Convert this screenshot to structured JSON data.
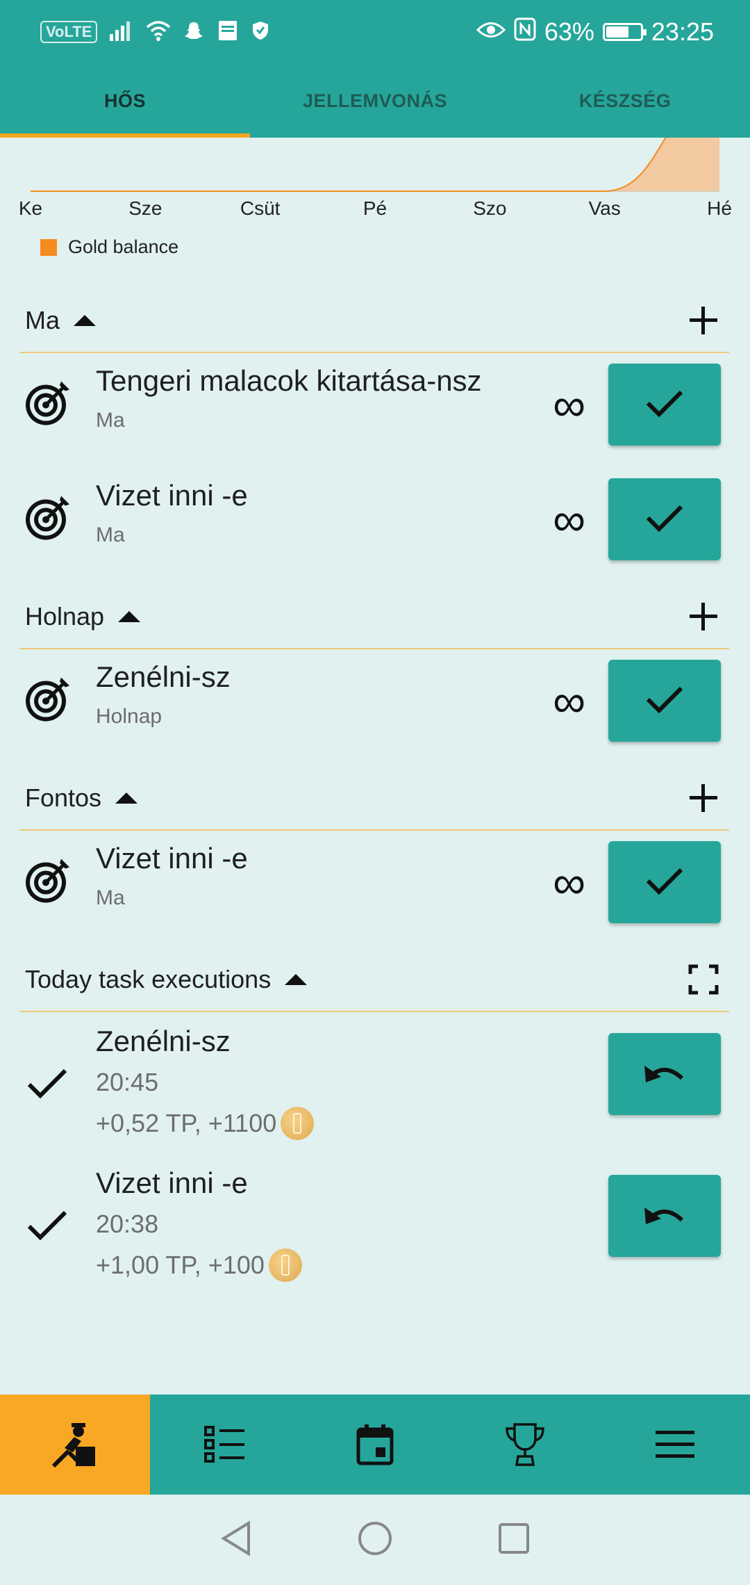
{
  "status_bar": {
    "volte": "VoLTE",
    "battery_percent": "63%",
    "battery_level": 0.63,
    "time": "23:25",
    "icons": [
      "signal-icon",
      "wifi-icon",
      "snapchat-icon",
      "bible-app-icon",
      "shield-icon",
      "eye-comfort-icon",
      "nfc-icon",
      "battery-icon"
    ]
  },
  "tabs": [
    {
      "label": "HŐS",
      "active": true
    },
    {
      "label": "JELLEMVONÁS",
      "active": false
    },
    {
      "label": "KÉSZSÉG",
      "active": false
    }
  ],
  "chart_data": {
    "type": "area",
    "categories": [
      "Ke",
      "Sze",
      "Csüt",
      "Pé",
      "Szo",
      "Vas",
      "Hé"
    ],
    "series": [
      {
        "name": "Gold balance",
        "values": [
          0,
          0,
          0,
          0,
          0,
          0,
          1200
        ],
        "color": "#f58a1f"
      }
    ],
    "legend": "bottom-left"
  },
  "sections": {
    "today": {
      "title": "Ma",
      "items": [
        {
          "title": "Tengeri malacok kitartása-nsz",
          "subtitle": "Ma"
        },
        {
          "title": "Vizet inni -e",
          "subtitle": "Ma"
        }
      ]
    },
    "tomorrow": {
      "title": "Holnap",
      "items": [
        {
          "title": "Zenélni-sz",
          "subtitle": "Holnap"
        }
      ]
    },
    "important": {
      "title": "Fontos",
      "items": [
        {
          "title": "Vizet inni -e",
          "subtitle": "Ma"
        }
      ]
    },
    "executions": {
      "title": "Today task executions",
      "items": [
        {
          "title": "Zenélni-sz",
          "time": "20:45",
          "reward": "+0,52 TP, +1100"
        },
        {
          "title": "Vizet inni -e",
          "time": "20:38",
          "reward": "+1,00 TP, +100"
        }
      ]
    }
  },
  "infinity_symbol": "∞",
  "colors": {
    "primary": "#26a69a",
    "accent": "#f5a623",
    "nav_active": "#f9a825",
    "background": "#e0f1f0",
    "divider": "#efc97a",
    "chart_fill": "#f58a1f"
  },
  "bottom_nav": [
    "hero-icon",
    "task-list-icon",
    "calendar-icon",
    "trophy-icon",
    "menu-icon"
  ]
}
